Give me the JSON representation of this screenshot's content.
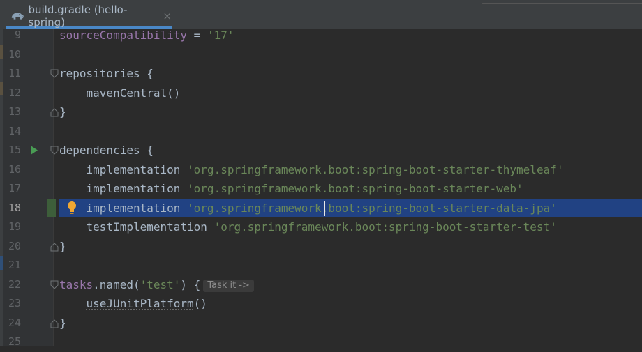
{
  "tab": {
    "label": "build.gradle (hello-spring)",
    "close": "×",
    "icon": "gradle-elephant-icon"
  },
  "colors": {
    "background": "#2b2b2b",
    "gutter": "#313335",
    "selection": "#214283",
    "keyword_property": "#9876aa",
    "string": "#6a8759",
    "text": "#a9b7c6",
    "line_number": "#606366",
    "tab_underline": "#4a88c7"
  },
  "editor": {
    "current_line": "18",
    "lines": [
      {
        "num": "9",
        "text": "sourceCompatibility = '17'"
      },
      {
        "num": "10",
        "text": ""
      },
      {
        "num": "11",
        "text": "repositories {"
      },
      {
        "num": "12",
        "text": "    mavenCentral()"
      },
      {
        "num": "13",
        "text": "}"
      },
      {
        "num": "14",
        "text": ""
      },
      {
        "num": "15",
        "text": "dependencies {"
      },
      {
        "num": "16",
        "text": "    implementation 'org.springframework.boot:spring-boot-starter-thymeleaf'"
      },
      {
        "num": "17",
        "text": "    implementation 'org.springframework.boot:spring-boot-starter-web'"
      },
      {
        "num": "18",
        "text": "    implementation 'org.springframework.boot:spring-boot-starter-data-jpa'"
      },
      {
        "num": "19",
        "text": "    testImplementation 'org.springframework.boot:spring-boot-starter-test'"
      },
      {
        "num": "20",
        "text": "}"
      },
      {
        "num": "21",
        "text": ""
      },
      {
        "num": "22",
        "text": "tasks.named('test') {"
      },
      {
        "num": "23",
        "text": "    useJUnitPlatform()"
      },
      {
        "num": "24",
        "text": "}"
      },
      {
        "num": "25",
        "text": ""
      }
    ],
    "inlay_hint": "Task it ->"
  },
  "tokens": {
    "l9_prop": "sourceCompatibility",
    "l9_eq": " = ",
    "l9_str": "'17'",
    "l11": "repositories {",
    "l12": "    mavenCentral()",
    "l13": "}",
    "l15": "dependencies {",
    "impl": "    implementation ",
    "timpl": "    testImplementation ",
    "dep16": "'org.springframework.boot:spring-boot-starter-thymeleaf'",
    "dep17": "'org.springframework.boot:spring-boot-starter-web'",
    "dep18": "'org.springframework.boot:spring-boot-starter-data-jpa'",
    "dep19": "'org.springframework.boot:spring-boot-starter-test'",
    "l20": "}",
    "l22_prop": "tasks",
    "l22_a": ".named(",
    "l22_str": "'test'",
    "l22_b": ") {",
    "l23_pre": "    ",
    "l23_fn": "useJUnitPlatform",
    "l23_post": "()",
    "l24": "}"
  }
}
